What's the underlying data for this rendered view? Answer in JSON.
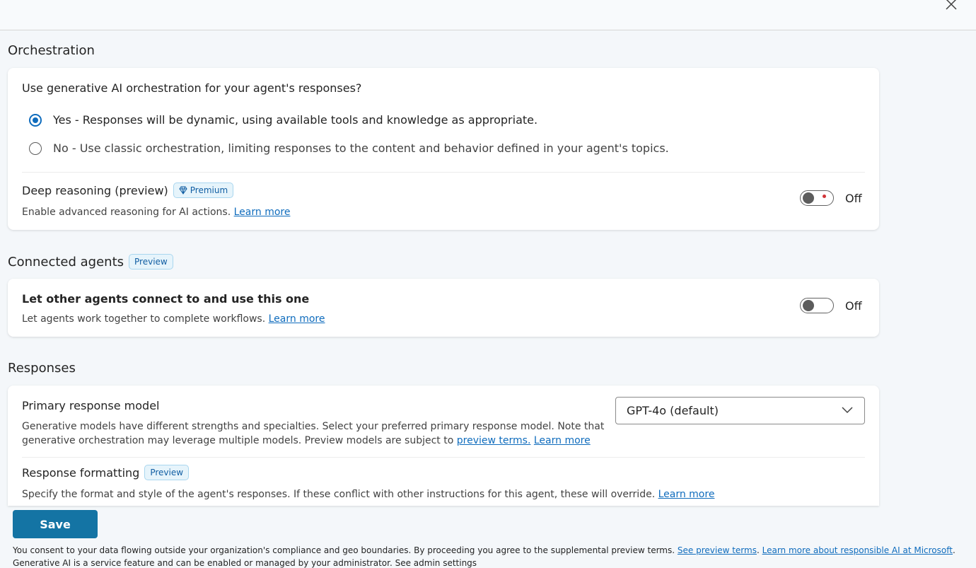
{
  "orchestration": {
    "title": "Orchestration",
    "question": "Use generative AI orchestration for your agent's responses?",
    "options": [
      "Yes - Responses will be dynamic, using available tools and knowledge as appropriate.",
      "No - Use classic orchestration, limiting responses to the content and behavior defined in your agent's topics."
    ],
    "selected_index": 0,
    "deep_reasoning": {
      "title": "Deep reasoning (preview)",
      "badge": "Premium",
      "badge_icon": "diamond-icon",
      "description": "Enable advanced reasoning for AI actions.",
      "link": "Learn more",
      "toggle_state": "Off"
    }
  },
  "connected_agents": {
    "title": "Connected agents",
    "badge": "Preview",
    "item_title": "Let other agents connect to and use this one",
    "description": "Let agents work together to complete workflows.",
    "link": "Learn more",
    "toggle_state": "Off"
  },
  "responses": {
    "title": "Responses",
    "primary_model": {
      "title": "Primary response model",
      "description_line1": "Generative models have different strengths and specialties. Select your preferred primary response model. Note that",
      "description_line2": "generative orchestration may leverage multiple models. Preview models are subject to",
      "preview_terms_link": "preview terms.",
      "learn_more_link": "Learn more",
      "selected_model": "GPT-4o (default)"
    },
    "formatting": {
      "title": "Response formatting",
      "badge": "Preview",
      "description": "Specify the format and style of the agent's responses. If these conflict with other instructions for this agent, these will override.",
      "link": "Learn more"
    }
  },
  "save_label": "Save",
  "footer": {
    "text": "You consent to your data flowing outside your organization's compliance and geo boundaries. By proceeding you agree to the supplemental preview terms.",
    "link1": "See preview terms",
    "link2": "Learn more about responsible AI at Microsoft",
    "line2": "Generative AI is a service feature and can be enabled or managed by your administrator. See admin settings"
  },
  "colors": {
    "accent": "#0f6cbd",
    "save_button": "#1474a4",
    "badge_bg": "#e6f4fb"
  }
}
